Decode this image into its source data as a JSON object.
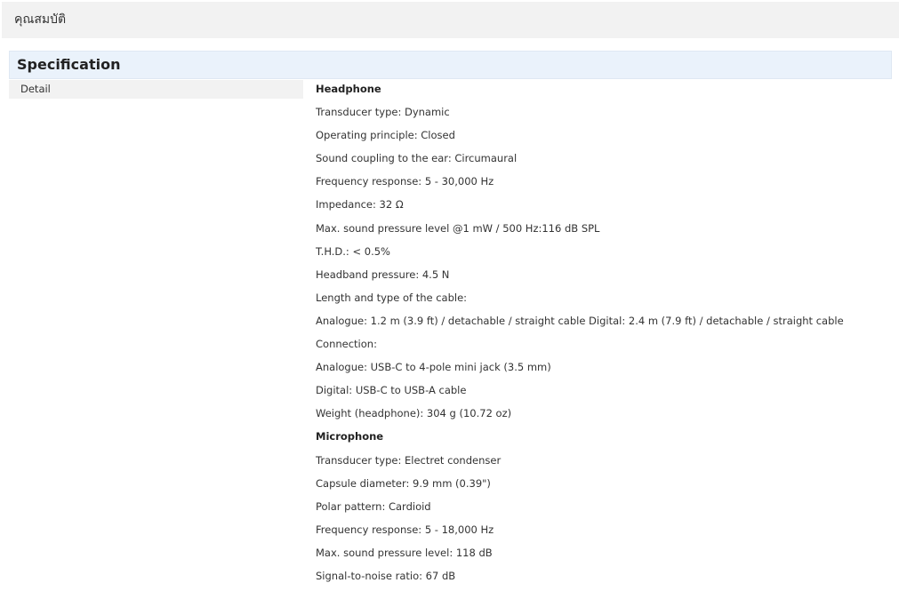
{
  "tab": {
    "title": "คุณสมบัติ"
  },
  "specification": {
    "title": "Specification",
    "detail_label": "Detail",
    "lines": [
      {
        "text": "Headphone",
        "heading": true
      },
      {
        "text": "Transducer type: Dynamic",
        "heading": false
      },
      {
        "text": "Operating principle: Closed",
        "heading": false
      },
      {
        "text": "Sound coupling to the ear: Circumaural",
        "heading": false
      },
      {
        "text": "Frequency response: 5 - 30,000 Hz",
        "heading": false
      },
      {
        "text": "Impedance: 32 Ω",
        "heading": false
      },
      {
        "text": "Max. sound pressure level @1 mW / 500 Hz:116 dB SPL",
        "heading": false
      },
      {
        "text": "T.H.D.: < 0.5%",
        "heading": false
      },
      {
        "text": "Headband pressure: 4.5 N",
        "heading": false
      },
      {
        "text": "Length and type of the cable:",
        "heading": false
      },
      {
        "text": "Analogue: 1.2 m (3.9 ft) / detachable / straight cable Digital: 2.4 m (7.9 ft) / detachable / straight cable",
        "heading": false
      },
      {
        "text": "Connection:",
        "heading": false
      },
      {
        "text": "Analogue: USB-C to 4-pole mini jack (3.5 mm)",
        "heading": false
      },
      {
        "text": "Digital: USB-C to USB-A cable",
        "heading": false
      },
      {
        "text": "Weight (headphone): 304 g (10.72 oz)",
        "heading": false
      },
      {
        "text": "Microphone",
        "heading": true
      },
      {
        "text": "Transducer type: Electret condenser",
        "heading": false
      },
      {
        "text": "Capsule diameter: 9.9 mm (0.39\")",
        "heading": false
      },
      {
        "text": "Polar pattern: Cardioid",
        "heading": false
      },
      {
        "text": "Frequency response: 5 - 18,000 Hz",
        "heading": false
      },
      {
        "text": "Max. sound pressure level: 118 dB",
        "heading": false
      },
      {
        "text": "Signal-to-noise ratio: 67 dB",
        "heading": false
      }
    ]
  }
}
